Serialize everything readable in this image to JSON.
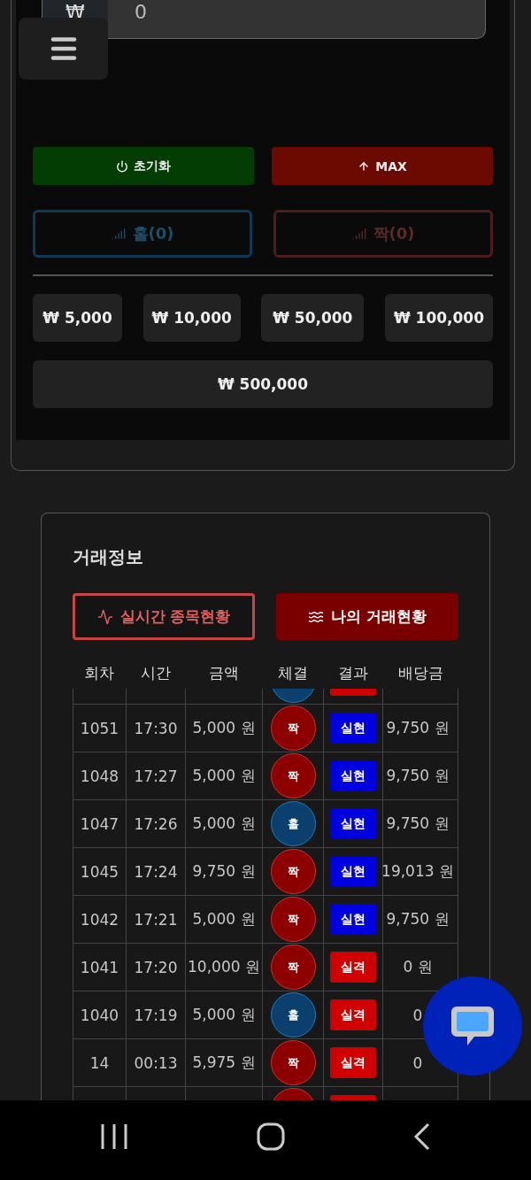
{
  "amount_field": {
    "currency": "₩",
    "value": "0"
  },
  "actions": [
    {
      "kind": "reset",
      "label": "초기화"
    },
    {
      "kind": "max",
      "label": "MAX"
    }
  ],
  "bets": [
    {
      "kind": "odd",
      "label": "홀(0)"
    },
    {
      "kind": "even",
      "label": "짝(0)"
    }
  ],
  "chips": [
    "₩ 5,000",
    "₩ 10,000",
    "₩ 50,000",
    "₩ 100,000",
    "₩ 500,000"
  ],
  "trade_info": {
    "title": "거래정보",
    "tabs": [
      {
        "label": "실시간 종목현황",
        "selected": false
      },
      {
        "label": "나의 거래현황",
        "selected": true
      }
    ],
    "columns": [
      "회차",
      "시간",
      "금액",
      "체결",
      "결과",
      "배당금"
    ],
    "rows": [
      {
        "kind": "cut",
        "bet": {
          "kind": "odd"
        },
        "result": {
          "kind": "lose"
        }
      },
      {
        "kind": "full",
        "round": "1051",
        "time": "17:30",
        "amount": "5,000 원",
        "bet": {
          "kind": "even",
          "label": "짝"
        },
        "result": {
          "kind": "win",
          "label": "실현"
        },
        "payout": "9,750 원"
      },
      {
        "kind": "full",
        "round": "1048",
        "time": "17:27",
        "amount": "5,000 원",
        "bet": {
          "kind": "even",
          "label": "짝"
        },
        "result": {
          "kind": "win",
          "label": "실현"
        },
        "payout": "9,750 원"
      },
      {
        "kind": "full",
        "round": "1047",
        "time": "17:26",
        "amount": "5,000 원",
        "bet": {
          "kind": "odd",
          "label": "홀"
        },
        "result": {
          "kind": "win",
          "label": "실현"
        },
        "payout": "9,750 원"
      },
      {
        "kind": "full",
        "round": "1045",
        "time": "17:24",
        "amount": "9,750 원",
        "bet": {
          "kind": "even",
          "label": "짝"
        },
        "result": {
          "kind": "win",
          "label": "실현"
        },
        "payout": "19,013 원"
      },
      {
        "kind": "full",
        "round": "1042",
        "time": "17:21",
        "amount": "5,000 원",
        "bet": {
          "kind": "even",
          "label": "짝"
        },
        "result": {
          "kind": "win",
          "label": "실현"
        },
        "payout": "9,750 원"
      },
      {
        "kind": "full",
        "round": "1041",
        "time": "17:20",
        "amount": "10,000 원",
        "bet": {
          "kind": "even",
          "label": "짝"
        },
        "result": {
          "kind": "lose",
          "label": "실격"
        },
        "payout": "0 원"
      },
      {
        "kind": "full",
        "round": "1040",
        "time": "17:19",
        "amount": "5,000 원",
        "bet": {
          "kind": "odd",
          "label": "홀"
        },
        "result": {
          "kind": "lose",
          "label": "실격"
        },
        "payout": "0"
      },
      {
        "kind": "full",
        "round": "14",
        "time": "00:13",
        "amount": "5,975 원",
        "bet": {
          "kind": "even",
          "label": "짝"
        },
        "result": {
          "kind": "lose",
          "label": "실격"
        },
        "payout": "0"
      },
      {
        "kind": "cut",
        "bet": {
          "kind": "even"
        },
        "result": {
          "kind": "lose"
        }
      }
    ]
  }
}
